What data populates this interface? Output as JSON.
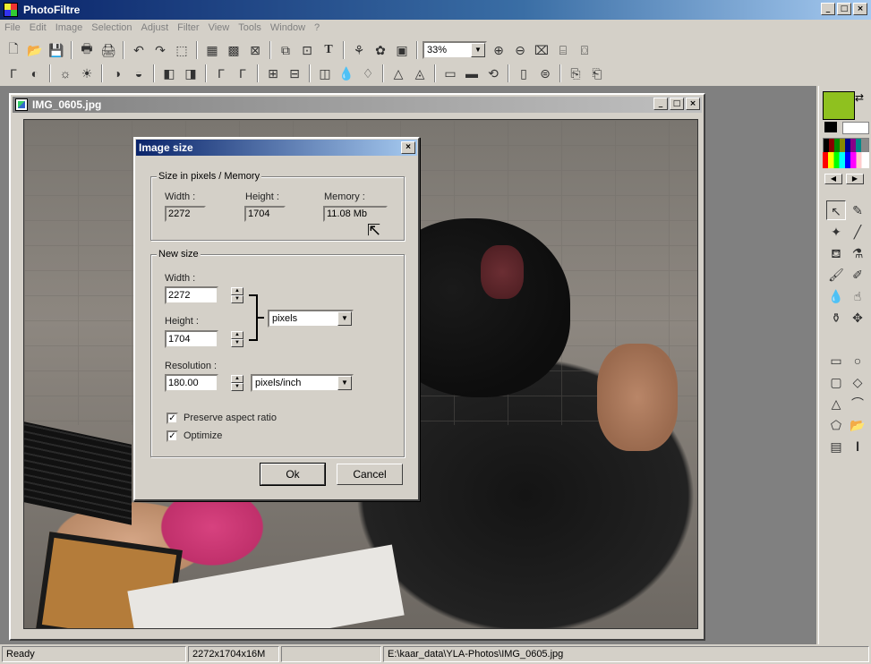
{
  "app": {
    "title": "PhotoFiltre",
    "window_buttons": [
      "_",
      "□",
      "×"
    ]
  },
  "menu": [
    "File",
    "Edit",
    "Image",
    "Selection",
    "Adjust",
    "Filter",
    "View",
    "Tools",
    "Window",
    "?"
  ],
  "toolbar": {
    "zoom_value": "33%"
  },
  "document": {
    "title": "IMG_0605.jpg",
    "window_buttons": [
      "_",
      "□",
      "×"
    ]
  },
  "dialog": {
    "title": "Image size",
    "close": "×",
    "size_group": {
      "label": "Size in pixels / Memory",
      "width_label": "Width :",
      "height_label": "Height :",
      "memory_label": "Memory :",
      "width": "2272",
      "height": "1704",
      "memory": "11.08 Mb"
    },
    "new_size_group": {
      "label": "New size",
      "width_label": "Width :",
      "width": "2272",
      "height_label": "Height :",
      "height": "1704",
      "unit": "pixels",
      "resolution_label": "Resolution :",
      "resolution": "180.00",
      "resolution_unit": "pixels/inch",
      "preserve_label": "Preserve aspect ratio",
      "preserve_checked": true,
      "optimize_label": "Optimize",
      "optimize_checked": true
    },
    "ok_label": "Ok",
    "cancel_label": "Cancel"
  },
  "palette": {
    "foreground_color": "#8fc11f",
    "background_color": "#ffffff"
  },
  "status": {
    "state": "Ready",
    "dimensions": "2272x1704x16M",
    "empty": "",
    "path": "E:\\kaar_data\\YLA-Photos\\IMG_0605.jpg"
  }
}
